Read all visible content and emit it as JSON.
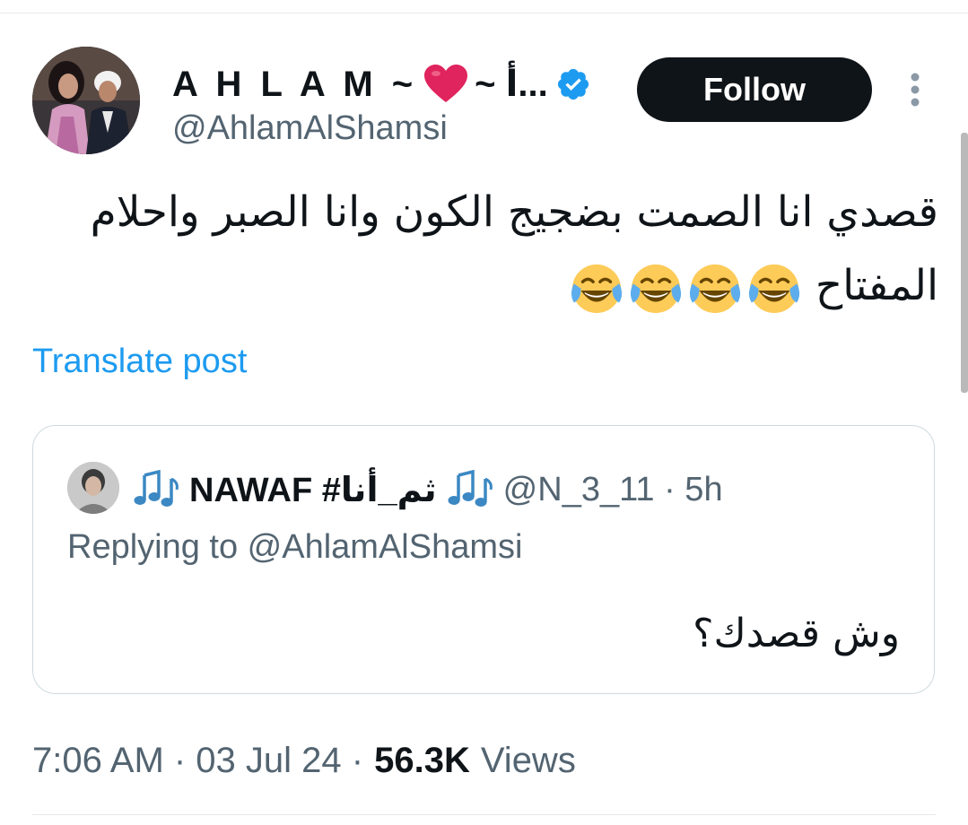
{
  "author": {
    "name_left": "A H L A M ~",
    "name_right": "~ أ...",
    "handle": "@AhlamAlShamsi",
    "verified": true,
    "accent_color": "#1d9bf0"
  },
  "follow_button": {
    "label": "Follow"
  },
  "tweet": {
    "text": "قصدي انا الصمت بضجيج الكون وانا الصبر واحلام المفتاح",
    "emojis": [
      "face-with-tears-of-joy",
      "face-with-tears-of-joy",
      "face-with-tears-of-joy",
      "face-with-tears-of-joy"
    ]
  },
  "translate": {
    "label": "Translate post"
  },
  "quote": {
    "name": "NAWAF #ثم_أنا",
    "handle_time": "@N_3_11 · 5h",
    "replying_to": "Replying to @AhlamAlShamsi",
    "text": "وش قصدك؟"
  },
  "meta": {
    "time_date": "7:06 AM · 03 Jul 24 ·",
    "views_count": "56.3K",
    "views_label": "Views"
  },
  "icons": [
    "heart-emoji-icon",
    "verified-badge-icon",
    "more-vertical-icon",
    "music-notes-icon",
    "laughing-emoji-icon"
  ]
}
